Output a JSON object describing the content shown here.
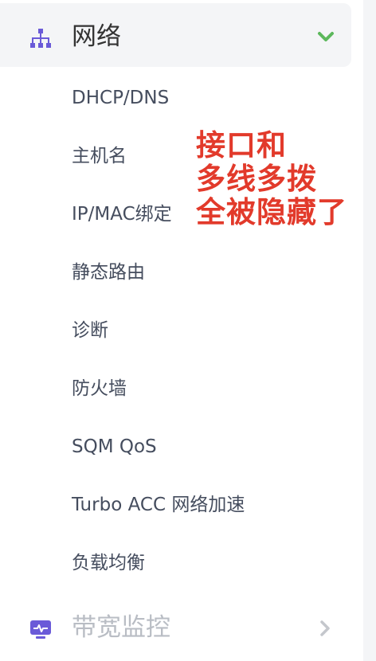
{
  "group": {
    "icon": "network-tree-icon",
    "title": "网络",
    "expanded": true,
    "chevron_icon": "chevron-down-icon"
  },
  "menu": {
    "items": [
      {
        "label": "DHCP/DNS"
      },
      {
        "label": "主机名"
      },
      {
        "label": "IP/MAC绑定"
      },
      {
        "label": "静态路由"
      },
      {
        "label": "诊断"
      },
      {
        "label": "防火墙"
      },
      {
        "label": "SQM QoS"
      },
      {
        "label": "Turbo ACC 网络加速"
      },
      {
        "label": "负载均衡"
      }
    ]
  },
  "annotation": {
    "lines": [
      "接口和",
      "多线多拨",
      "全被隐藏了"
    ],
    "color": "#e23a2b"
  },
  "next_group": {
    "icon": "monitor-icon",
    "title": "带宽监控",
    "chevron_icon": "chevron-right-icon"
  },
  "colors": {
    "accent": "#6a5ad8",
    "chevron_green": "#5cb85c",
    "menu_text": "#454d5e",
    "muted": "#b9bdc4"
  }
}
